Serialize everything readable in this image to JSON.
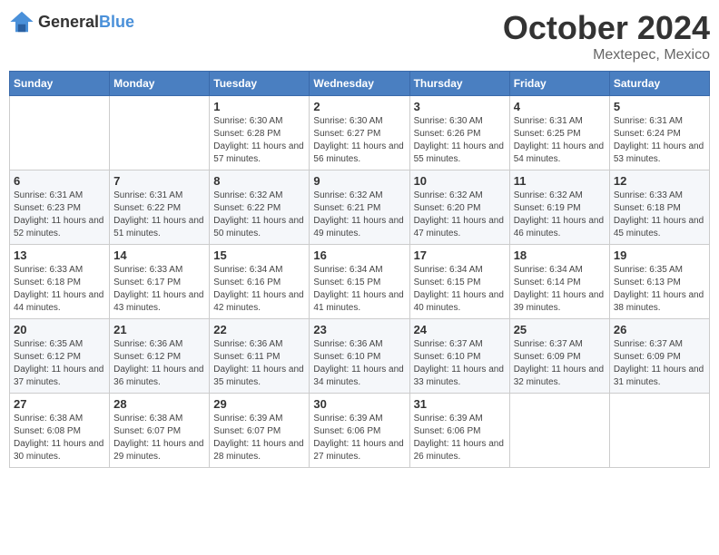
{
  "header": {
    "logo": {
      "text1": "General",
      "text2": "Blue"
    },
    "title": "October 2024",
    "location": "Mextepec, Mexico"
  },
  "calendar": {
    "weekdays": [
      "Sunday",
      "Monday",
      "Tuesday",
      "Wednesday",
      "Thursday",
      "Friday",
      "Saturday"
    ],
    "weeks": [
      [
        {
          "day": "",
          "sunrise": "",
          "sunset": "",
          "daylight": ""
        },
        {
          "day": "",
          "sunrise": "",
          "sunset": "",
          "daylight": ""
        },
        {
          "day": "1",
          "sunrise": "Sunrise: 6:30 AM",
          "sunset": "Sunset: 6:28 PM",
          "daylight": "Daylight: 11 hours and 57 minutes."
        },
        {
          "day": "2",
          "sunrise": "Sunrise: 6:30 AM",
          "sunset": "Sunset: 6:27 PM",
          "daylight": "Daylight: 11 hours and 56 minutes."
        },
        {
          "day": "3",
          "sunrise": "Sunrise: 6:30 AM",
          "sunset": "Sunset: 6:26 PM",
          "daylight": "Daylight: 11 hours and 55 minutes."
        },
        {
          "day": "4",
          "sunrise": "Sunrise: 6:31 AM",
          "sunset": "Sunset: 6:25 PM",
          "daylight": "Daylight: 11 hours and 54 minutes."
        },
        {
          "day": "5",
          "sunrise": "Sunrise: 6:31 AM",
          "sunset": "Sunset: 6:24 PM",
          "daylight": "Daylight: 11 hours and 53 minutes."
        }
      ],
      [
        {
          "day": "6",
          "sunrise": "Sunrise: 6:31 AM",
          "sunset": "Sunset: 6:23 PM",
          "daylight": "Daylight: 11 hours and 52 minutes."
        },
        {
          "day": "7",
          "sunrise": "Sunrise: 6:31 AM",
          "sunset": "Sunset: 6:22 PM",
          "daylight": "Daylight: 11 hours and 51 minutes."
        },
        {
          "day": "8",
          "sunrise": "Sunrise: 6:32 AM",
          "sunset": "Sunset: 6:22 PM",
          "daylight": "Daylight: 11 hours and 50 minutes."
        },
        {
          "day": "9",
          "sunrise": "Sunrise: 6:32 AM",
          "sunset": "Sunset: 6:21 PM",
          "daylight": "Daylight: 11 hours and 49 minutes."
        },
        {
          "day": "10",
          "sunrise": "Sunrise: 6:32 AM",
          "sunset": "Sunset: 6:20 PM",
          "daylight": "Daylight: 11 hours and 47 minutes."
        },
        {
          "day": "11",
          "sunrise": "Sunrise: 6:32 AM",
          "sunset": "Sunset: 6:19 PM",
          "daylight": "Daylight: 11 hours and 46 minutes."
        },
        {
          "day": "12",
          "sunrise": "Sunrise: 6:33 AM",
          "sunset": "Sunset: 6:18 PM",
          "daylight": "Daylight: 11 hours and 45 minutes."
        }
      ],
      [
        {
          "day": "13",
          "sunrise": "Sunrise: 6:33 AM",
          "sunset": "Sunset: 6:18 PM",
          "daylight": "Daylight: 11 hours and 44 minutes."
        },
        {
          "day": "14",
          "sunrise": "Sunrise: 6:33 AM",
          "sunset": "Sunset: 6:17 PM",
          "daylight": "Daylight: 11 hours and 43 minutes."
        },
        {
          "day": "15",
          "sunrise": "Sunrise: 6:34 AM",
          "sunset": "Sunset: 6:16 PM",
          "daylight": "Daylight: 11 hours and 42 minutes."
        },
        {
          "day": "16",
          "sunrise": "Sunrise: 6:34 AM",
          "sunset": "Sunset: 6:15 PM",
          "daylight": "Daylight: 11 hours and 41 minutes."
        },
        {
          "day": "17",
          "sunrise": "Sunrise: 6:34 AM",
          "sunset": "Sunset: 6:15 PM",
          "daylight": "Daylight: 11 hours and 40 minutes."
        },
        {
          "day": "18",
          "sunrise": "Sunrise: 6:34 AM",
          "sunset": "Sunset: 6:14 PM",
          "daylight": "Daylight: 11 hours and 39 minutes."
        },
        {
          "day": "19",
          "sunrise": "Sunrise: 6:35 AM",
          "sunset": "Sunset: 6:13 PM",
          "daylight": "Daylight: 11 hours and 38 minutes."
        }
      ],
      [
        {
          "day": "20",
          "sunrise": "Sunrise: 6:35 AM",
          "sunset": "Sunset: 6:12 PM",
          "daylight": "Daylight: 11 hours and 37 minutes."
        },
        {
          "day": "21",
          "sunrise": "Sunrise: 6:36 AM",
          "sunset": "Sunset: 6:12 PM",
          "daylight": "Daylight: 11 hours and 36 minutes."
        },
        {
          "day": "22",
          "sunrise": "Sunrise: 6:36 AM",
          "sunset": "Sunset: 6:11 PM",
          "daylight": "Daylight: 11 hours and 35 minutes."
        },
        {
          "day": "23",
          "sunrise": "Sunrise: 6:36 AM",
          "sunset": "Sunset: 6:10 PM",
          "daylight": "Daylight: 11 hours and 34 minutes."
        },
        {
          "day": "24",
          "sunrise": "Sunrise: 6:37 AM",
          "sunset": "Sunset: 6:10 PM",
          "daylight": "Daylight: 11 hours and 33 minutes."
        },
        {
          "day": "25",
          "sunrise": "Sunrise: 6:37 AM",
          "sunset": "Sunset: 6:09 PM",
          "daylight": "Daylight: 11 hours and 32 minutes."
        },
        {
          "day": "26",
          "sunrise": "Sunrise: 6:37 AM",
          "sunset": "Sunset: 6:09 PM",
          "daylight": "Daylight: 11 hours and 31 minutes."
        }
      ],
      [
        {
          "day": "27",
          "sunrise": "Sunrise: 6:38 AM",
          "sunset": "Sunset: 6:08 PM",
          "daylight": "Daylight: 11 hours and 30 minutes."
        },
        {
          "day": "28",
          "sunrise": "Sunrise: 6:38 AM",
          "sunset": "Sunset: 6:07 PM",
          "daylight": "Daylight: 11 hours and 29 minutes."
        },
        {
          "day": "29",
          "sunrise": "Sunrise: 6:39 AM",
          "sunset": "Sunset: 6:07 PM",
          "daylight": "Daylight: 11 hours and 28 minutes."
        },
        {
          "day": "30",
          "sunrise": "Sunrise: 6:39 AM",
          "sunset": "Sunset: 6:06 PM",
          "daylight": "Daylight: 11 hours and 27 minutes."
        },
        {
          "day": "31",
          "sunrise": "Sunrise: 6:39 AM",
          "sunset": "Sunset: 6:06 PM",
          "daylight": "Daylight: 11 hours and 26 minutes."
        },
        {
          "day": "",
          "sunrise": "",
          "sunset": "",
          "daylight": ""
        },
        {
          "day": "",
          "sunrise": "",
          "sunset": "",
          "daylight": ""
        }
      ]
    ]
  }
}
